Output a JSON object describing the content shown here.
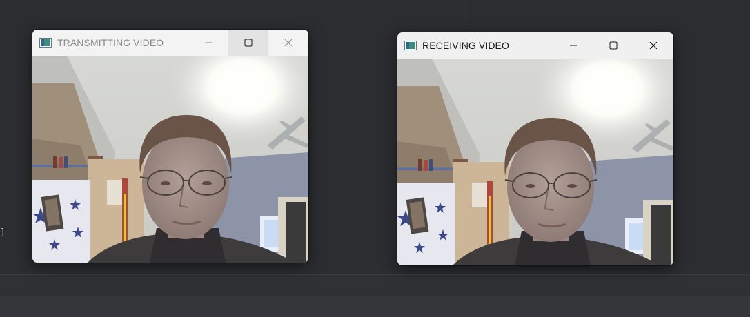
{
  "windows": {
    "transmit": {
      "title": "TRANSMITTING VIDEO",
      "state": "inactive",
      "buttons": {
        "minimize": "minimize-icon",
        "maximize": "maximize-icon",
        "close": "close-icon"
      }
    },
    "receive": {
      "title": "RECEIVING VIDEO",
      "state": "active",
      "buttons": {
        "minimize": "minimize-icon",
        "maximize": "maximize-icon",
        "close": "close-icon"
      }
    }
  },
  "background": {
    "editor_fragment": "]"
  },
  "colors": {
    "ide_background": "#2b2d30",
    "titlebar_inactive": "#f3f3f3",
    "titlebar_active": "#f0f0f0"
  }
}
